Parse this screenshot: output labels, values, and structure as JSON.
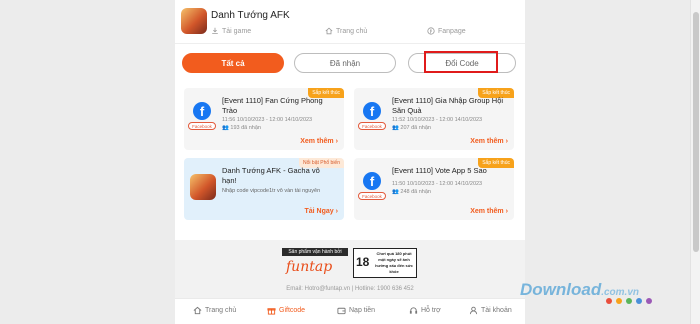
{
  "header": {
    "game_title": "Danh Tướng AFK",
    "links": [
      {
        "label": "Tải game",
        "icon": "download-icon"
      },
      {
        "label": "Trang chủ",
        "icon": "home-icon"
      },
      {
        "label": "Fanpage",
        "icon": "facebook-icon"
      }
    ]
  },
  "tabs": [
    {
      "label": "Tất cả",
      "active": true
    },
    {
      "label": "Đã nhận",
      "active": false
    },
    {
      "label": "Đổi Code",
      "active": false
    }
  ],
  "cards": [
    {
      "badge": "Sắp kết thúc",
      "logo": "facebook-icon",
      "logo_label": "Facebook",
      "title": "[Event 1110] Fan Cứng Phong Trào",
      "date": "11:56 10/10/2023 - 12:00 14/10/2023",
      "received": "193 đã nhận",
      "action": "Xem thêm"
    },
    {
      "badge": "Sắp kết thúc",
      "logo": "facebook-icon",
      "logo_label": "Facebook",
      "title": "[Event 1110] Gia Nhập Group Hội Săn Quà",
      "date": "11:52 10/10/2023 - 12:00 14/10/2023",
      "received": "207 đã nhận",
      "action": "Xem thêm"
    },
    {
      "badge": "Nổi bật Phổ biến",
      "logo": "game-icon",
      "title": "Danh Tướng AFK - Gacha vô hạn!",
      "desc": "Nhập code vipcode1tr vô vàn tài nguyên",
      "action": "Tải Ngay"
    },
    {
      "badge": "Sắp kết thúc",
      "logo": "facebook-icon",
      "logo_label": "Facebook",
      "title": "[Event 1110] Vote App 5 Sao",
      "date": "11:50 10/10/2023 - 12:00 14/10/2023",
      "received": "248 đã nhận",
      "action": "Xem thêm"
    }
  ],
  "footer": {
    "publisher_label": "Sản phẩm vận hành bởi",
    "publisher_logo": "funtap",
    "age_rating": "18",
    "age_note": "Chơi quá 180 phút một ngày sẽ ảnh hưởng xấu đến sức khỏe",
    "contact": "Email: Hotro@funtap.vn | Hotline: 1900 636 452"
  },
  "bottom_nav": [
    {
      "label": "Trang chủ",
      "icon": "home-icon",
      "active": false
    },
    {
      "label": "Giftcode",
      "icon": "gift-icon",
      "active": true
    },
    {
      "label": "Nạp tiền",
      "icon": "wallet-icon",
      "active": false
    },
    {
      "label": "Hỗ trợ",
      "icon": "headset-icon",
      "active": false
    },
    {
      "label": "Tài khoản",
      "icon": "user-icon",
      "active": false
    }
  ],
  "watermark": {
    "text": "Download",
    "tld": ".com.vn"
  },
  "colors": {
    "accent": "#f25c1e",
    "facebook": "#1877f2",
    "badge": "#f7a21b",
    "highlight_box": "#e01b1b",
    "watermark_dots": [
      "#e94e3c",
      "#f7a21b",
      "#5bb55b",
      "#4a90d9",
      "#9b59b6"
    ]
  }
}
